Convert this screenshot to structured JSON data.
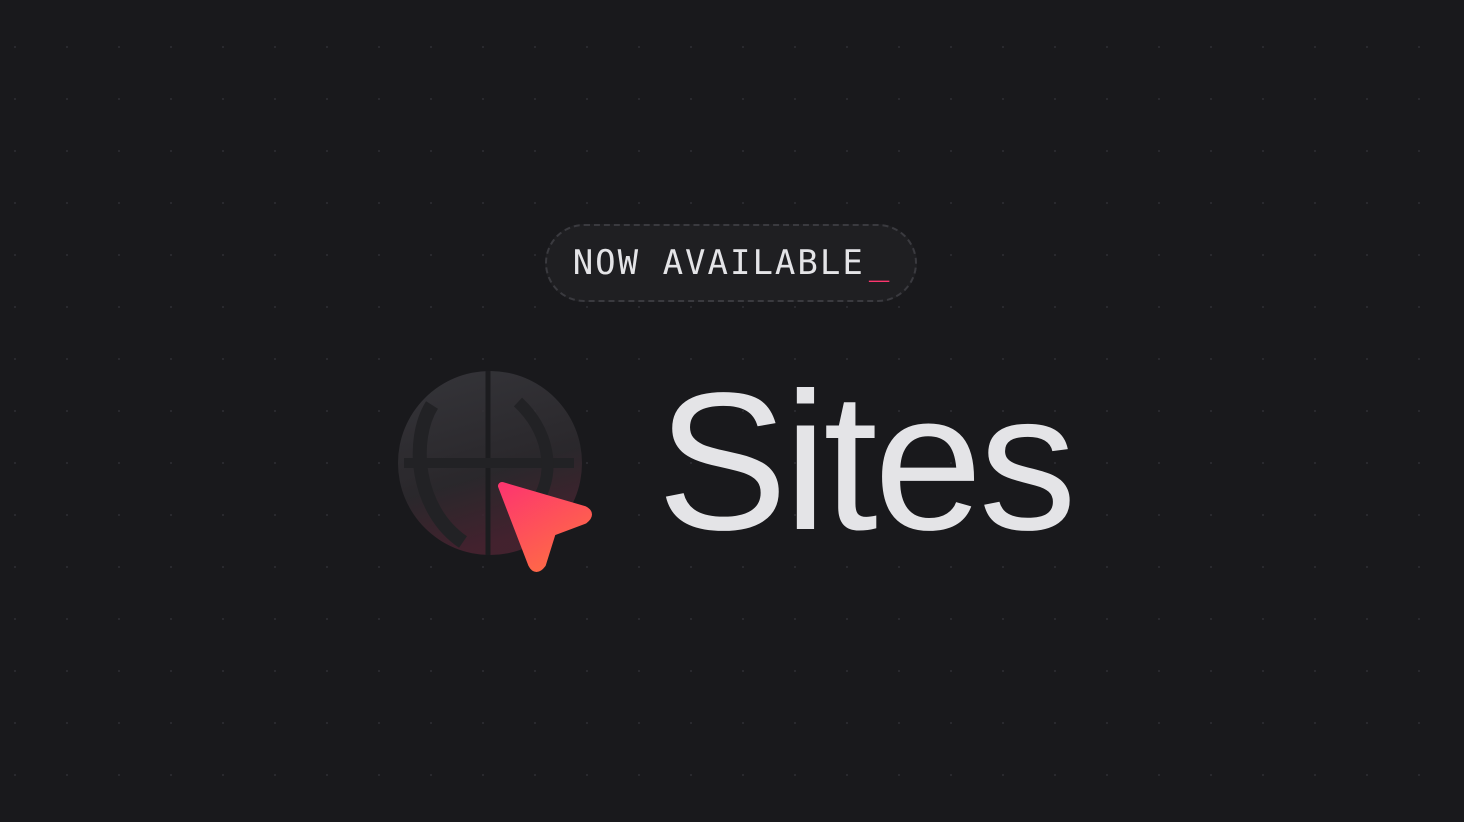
{
  "badge": {
    "text": "NOW AVAILABLE",
    "cursor": "_"
  },
  "product": {
    "name": "Sites"
  },
  "logo": {
    "globe_icon": "globe-icon",
    "cursor_icon": "cursor-arrow-icon"
  },
  "colors": {
    "background": "#19191c",
    "accent": "#fd366e",
    "text": "#e4e4e7"
  }
}
